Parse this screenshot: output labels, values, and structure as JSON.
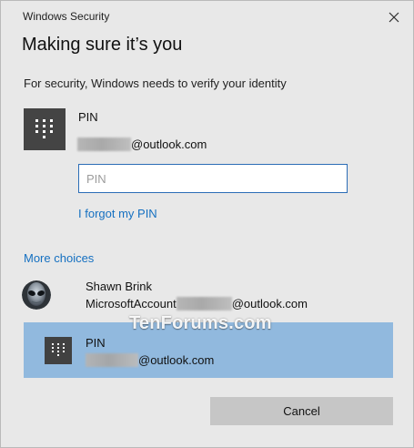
{
  "window": {
    "title": "Windows Security"
  },
  "dialog": {
    "heading": "Making sure it’s you",
    "subtext": "For security, Windows needs to verify your identity"
  },
  "primary_pin": {
    "title": "PIN",
    "account_suffix": "@outlook.com",
    "input_placeholder": "PIN",
    "input_value": "",
    "forgot_link": "I forgot my PIN"
  },
  "more_choices": {
    "label": "More choices",
    "items": [
      {
        "name": "Shawn Brink",
        "account_prefix": "MicrosoftAccount",
        "account_suffix": "@outlook.com",
        "icon": "alien-avatar-icon",
        "selected": false
      },
      {
        "name": "PIN",
        "account_suffix": "@outlook.com",
        "icon": "keypad-icon",
        "selected": true
      }
    ]
  },
  "buttons": {
    "cancel": "Cancel"
  },
  "watermark": {
    "text": "TenForums.com"
  },
  "colors": {
    "dialog_background": "#e8e8e8",
    "accent_link": "#1570c1",
    "selected_row": "#91b9de",
    "input_border": "#2b6db6",
    "cancel_button": "#c6c6c6"
  }
}
